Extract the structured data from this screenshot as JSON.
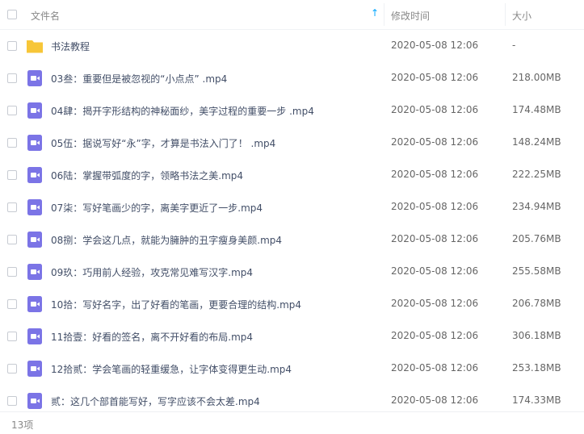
{
  "header": {
    "name_label": "文件名",
    "modified_label": "修改时间",
    "size_label": "大小",
    "sort_icon": "sort-ascending-arrow"
  },
  "colors": {
    "folder": "#f7c638",
    "video": "#7b74e6",
    "accent": "#06a7ff"
  },
  "files": [
    {
      "type": "folder",
      "name": "书法教程",
      "modified": "2020-05-08 12:06",
      "size": "-"
    },
    {
      "type": "video",
      "name": "03叁：重要但是被忽视的“小点点” .mp4",
      "modified": "2020-05-08 12:06",
      "size": "218.00MB"
    },
    {
      "type": "video",
      "name": "04肆：揭开字形结构的神秘面纱，美字过程的重要一步 .mp4",
      "modified": "2020-05-08 12:06",
      "size": "174.48MB"
    },
    {
      "type": "video",
      "name": "05伍：据说写好“永”字，才算是书法入门了！ .mp4",
      "modified": "2020-05-08 12:06",
      "size": "148.24MB"
    },
    {
      "type": "video",
      "name": "06陆：掌握带弧度的字，领略书法之美.mp4",
      "modified": "2020-05-08 12:06",
      "size": "222.25MB"
    },
    {
      "type": "video",
      "name": "07柒：写好笔画少的字，离美字更近了一步.mp4",
      "modified": "2020-05-08 12:06",
      "size": "234.94MB"
    },
    {
      "type": "video",
      "name": "08捌：学会这几点，就能为臃肿的丑字瘦身美颜.mp4",
      "modified": "2020-05-08 12:06",
      "size": "205.76MB"
    },
    {
      "type": "video",
      "name": "09玖：巧用前人经验，攻克常见难写汉字.mp4",
      "modified": "2020-05-08 12:06",
      "size": "255.58MB"
    },
    {
      "type": "video",
      "name": "10拾：写好名字，出了好看的笔画，更要合理的结构.mp4",
      "modified": "2020-05-08 12:06",
      "size": "206.78MB"
    },
    {
      "type": "video",
      "name": "11拾壹：好看的签名，离不开好看的布局.mp4",
      "modified": "2020-05-08 12:06",
      "size": "306.18MB"
    },
    {
      "type": "video",
      "name": "12拾贰：学会笔画的轻重缓急，让字体变得更生动.mp4",
      "modified": "2020-05-08 12:06",
      "size": "253.18MB"
    },
    {
      "type": "video",
      "name": "贰：这几个部首能写好，写字应该不会太差.mp4",
      "modified": "2020-05-08 12:06",
      "size": "174.33MB"
    }
  ],
  "footer": {
    "count": "13项"
  }
}
